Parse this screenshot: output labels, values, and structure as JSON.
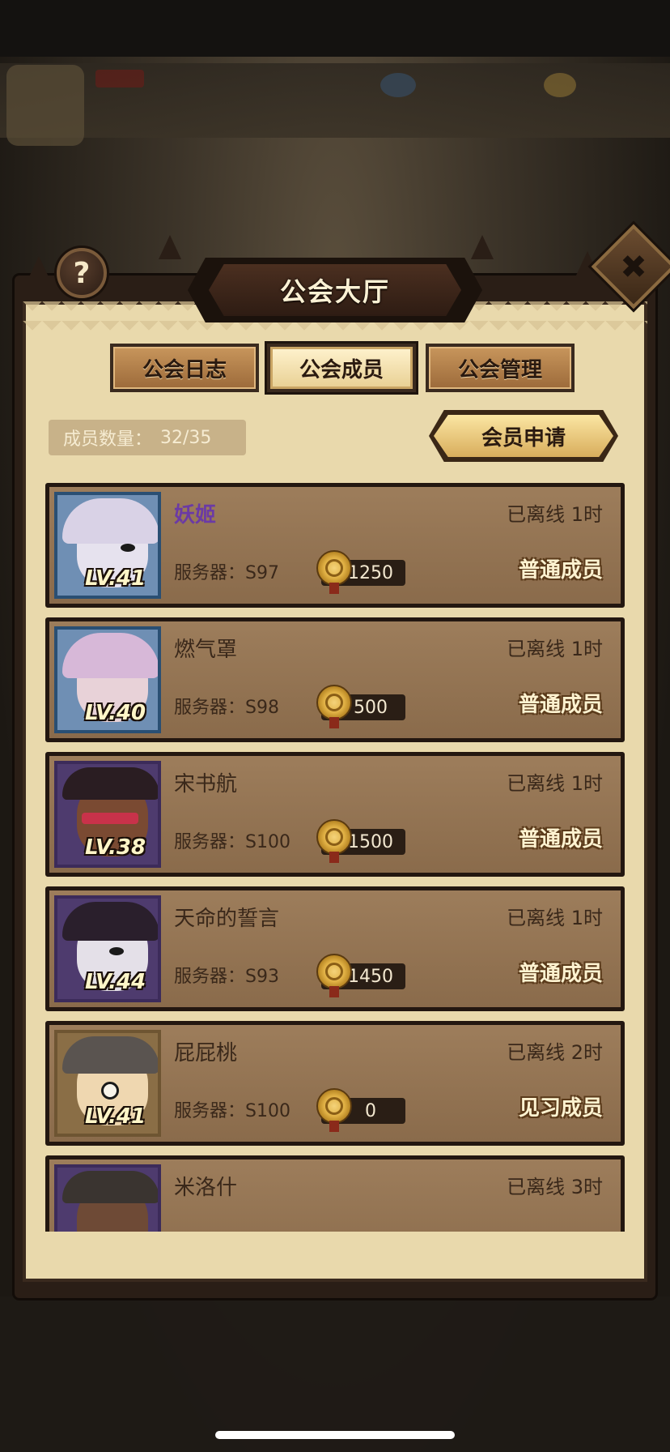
{
  "title": "公会大厅",
  "help_label": "?",
  "close_label": "✖",
  "tabs": [
    {
      "label": "公会日志",
      "active": false
    },
    {
      "label": "公会成员",
      "active": true
    },
    {
      "label": "公会管理",
      "active": false
    }
  ],
  "member_count": {
    "label": "成员数量：",
    "value": "32/35"
  },
  "apply_button": "会员申请",
  "server_label": "服务器：",
  "members": [
    {
      "name": "妖姬",
      "level": "LV.41",
      "server": "S97",
      "contribution": "1250",
      "offline": "已离线 1时",
      "role": "普通成员",
      "name_color": "#6b3aa5"
    },
    {
      "name": "燃气罩",
      "level": "LV.40",
      "server": "S98",
      "contribution": "500",
      "offline": "已离线 1时",
      "role": "普通成员"
    },
    {
      "name": "宋书航",
      "level": "LV.38",
      "server": "S100",
      "contribution": "1500",
      "offline": "已离线 1时",
      "role": "普通成员"
    },
    {
      "name": "天命的誓言",
      "level": "LV.44",
      "server": "S93",
      "contribution": "1450",
      "offline": "已离线 1时",
      "role": "普通成员"
    },
    {
      "name": "屁屁桃",
      "level": "LV.41",
      "server": "S100",
      "contribution": "0",
      "offline": "已离线 2时",
      "role": "见习成员"
    },
    {
      "name": "米洛什",
      "level": "",
      "server": "",
      "contribution": "",
      "offline": "已离线 3时",
      "role": ""
    }
  ],
  "colors": {
    "panel_bg": "#e9d9ac",
    "card_bg": "#9d7d5b",
    "frame": "#231710",
    "special_name": "#6b3aa5"
  }
}
